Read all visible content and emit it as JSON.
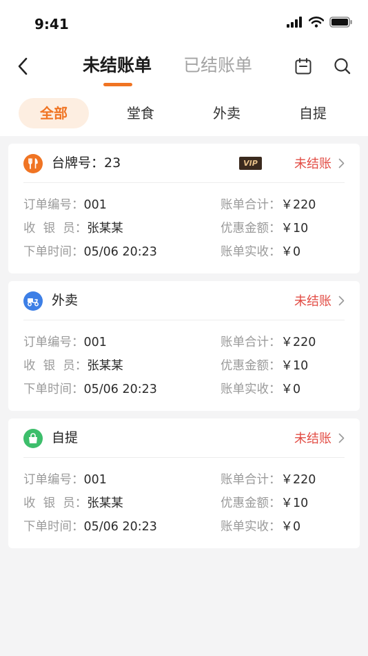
{
  "status_bar": {
    "time": "9:41"
  },
  "nav": {
    "tabs": [
      {
        "label": "未结账单"
      },
      {
        "label": "已结账单"
      }
    ]
  },
  "filters": [
    "全部",
    "堂食",
    "外卖",
    "自提"
  ],
  "cards": [
    {
      "title": "台牌号：23",
      "badge": "VIP",
      "status": "未结账",
      "order_no_label": "订单编号：",
      "order_no": "001",
      "cashier_label": "收  银  员：",
      "cashier": "张某某",
      "time_label": "下单时间：",
      "time": "05/06 20:23",
      "total_label": "账单合计：",
      "total": "￥220",
      "discount_label": "优惠金额：",
      "discount": "￥10",
      "received_label": "账单实收：",
      "received": "￥0"
    },
    {
      "title": "外卖",
      "status": "未结账",
      "order_no_label": "订单编号：",
      "order_no": "001",
      "cashier_label": "收  银  员：",
      "cashier": "张某某",
      "time_label": "下单时间：",
      "time": "05/06 20:23",
      "total_label": "账单合计：",
      "total": "￥220",
      "discount_label": "优惠金额：",
      "discount": "￥10",
      "received_label": "账单实收：",
      "received": "￥0"
    },
    {
      "title": "自提",
      "status": "未结账",
      "order_no_label": "订单编号：",
      "order_no": "001",
      "cashier_label": "收  银  员：",
      "cashier": "张某某",
      "time_label": "下单时间：",
      "time": "05/06 20:23",
      "total_label": "账单合计：",
      "total": "￥220",
      "discount_label": "优惠金额：",
      "discount": "￥10",
      "received_label": "账单实收：",
      "received": "￥0"
    }
  ],
  "colors": {
    "accent": "#f07423",
    "unpaid": "#e24b43",
    "dine_in": "#f07423",
    "delivery": "#3d7fe6",
    "pickup": "#3dbe6b"
  }
}
